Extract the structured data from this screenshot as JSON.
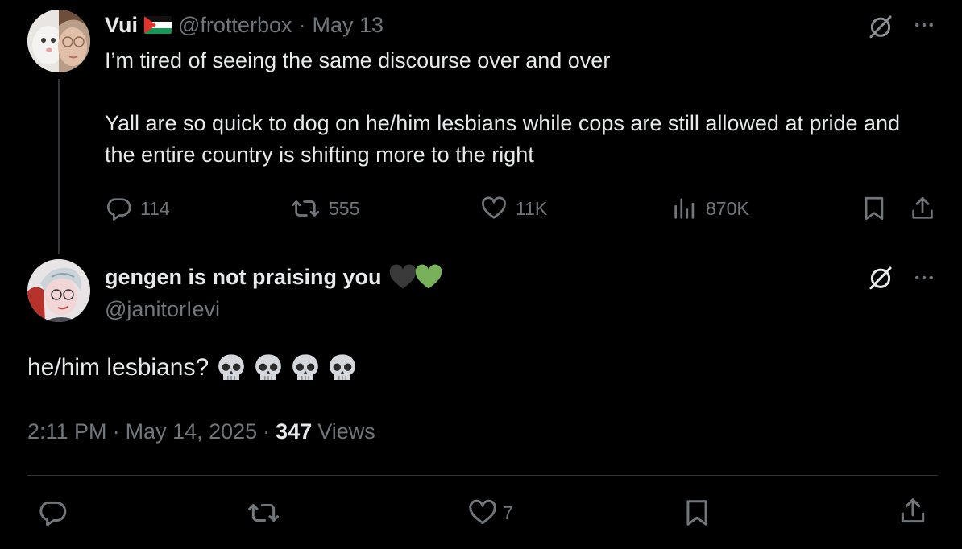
{
  "tweet1": {
    "display_name": "Vui",
    "handle": "@frotterbox",
    "separator": "·",
    "date": "May 13",
    "text": "I’m tired of seeing the same discourse over and over\n\nYall are so quick to dog on he/him lesbians while cops are still allowed at pride and the entire country is shifting more to the right",
    "replies": "114",
    "reposts": "555",
    "likes": "11K",
    "views": "870K",
    "icons": [
      "grok-icon",
      "more-icon",
      "reply-icon",
      "repost-icon",
      "like-icon",
      "views-icon",
      "bookmark-icon",
      "share-icon"
    ]
  },
  "tweet2": {
    "display_name": "gengen is not praising you",
    "handle": "@janitorIevi",
    "text": "he/him lesbians?",
    "emoji_count": 4,
    "time": "2:11 PM",
    "sep1": "·",
    "date": "May 14, 2025",
    "sep2": "·",
    "views_count": "347",
    "views_label": "Views",
    "likes": "7",
    "icons": [
      "grok-icon",
      "more-icon",
      "reply-icon",
      "repost-icon",
      "like-icon",
      "bookmark-icon",
      "share-icon"
    ]
  },
  "colors": {
    "background": "#000000",
    "text": "#e7e9ea",
    "muted": "#71767b",
    "divider": "#2f3336",
    "black_heart": "#3a3a3a",
    "green_heart": "#78b159"
  }
}
